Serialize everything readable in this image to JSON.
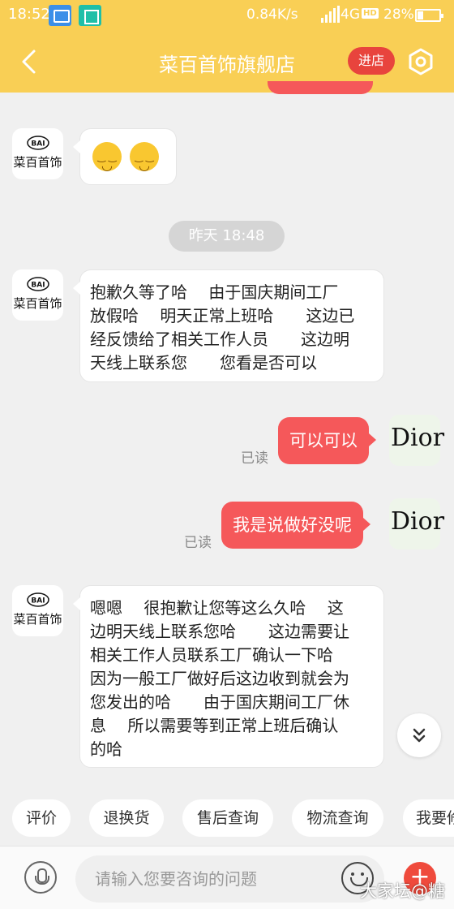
{
  "status_bar": {
    "time": "18:52",
    "network_speed": "0.84K/s",
    "network_type": "4G",
    "hd": "HD",
    "battery": "28%"
  },
  "nav": {
    "title": "菜百首饰旗舰店",
    "enter_store": "进店"
  },
  "shop": {
    "avatar_label": "菜百首饰",
    "logo_text": "BAI"
  },
  "messages": {
    "msg1_emoji_icons": [
      "smiling-face-icon",
      "smiling-face-icon"
    ],
    "timestamp": "昨天  18:48",
    "msg2_lines": [
      "抱歉久等了哈　 由于国庆期间工厂",
      "放假哈　 明天正常上班哈　　这边已",
      "经反馈给了相关工作人员　　这边明",
      "天线上联系您　　您看是否可以"
    ],
    "msg3_text": "可以可以",
    "msg3_status": "已读",
    "msg4_text": "我是说做好没呢",
    "msg4_status": "已读",
    "msg5_lines": [
      "嗯嗯　 很抱歉让您等这么久哈　 这",
      "边明天线上联系您哈　　这边需要让",
      "相关工作人员联系工厂确认一下哈",
      "因为一般工厂做好后这边收到就会为",
      "您发出的哈　　由于国庆期间工厂休",
      "息　 所以需要等到正常上班后确认",
      "的哈"
    ],
    "user_avatar_text": "Dior"
  },
  "quick_replies": [
    "评价",
    "退换货",
    "售后查询",
    "物流查询",
    "我要修"
  ],
  "input": {
    "placeholder": "请输入您要咨询的问题"
  },
  "watermark": "大家坛@糖",
  "colors": {
    "header": "#f9cf55",
    "accent_red": "#f5585a",
    "background": "#f0f0f0"
  }
}
